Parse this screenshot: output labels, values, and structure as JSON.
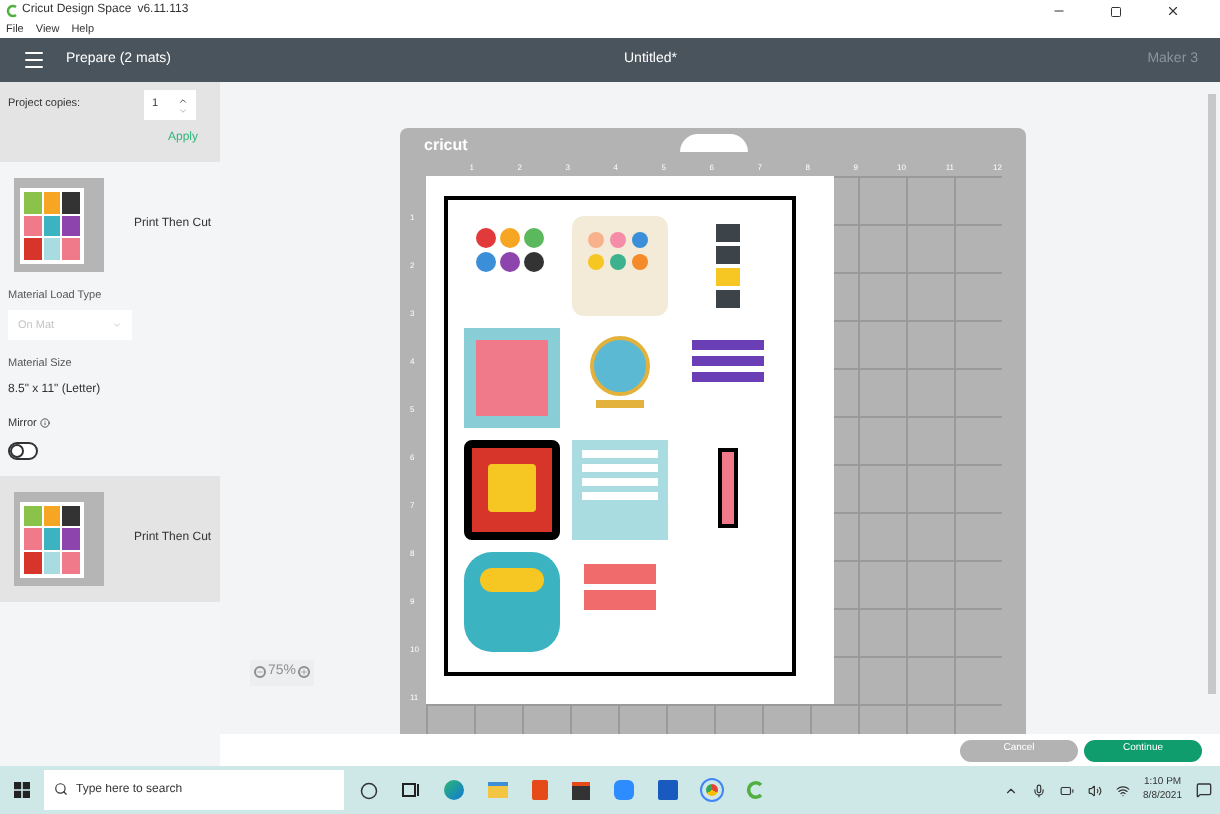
{
  "window": {
    "title": "Cricut Design Space",
    "version": "v6.11.113"
  },
  "menu": [
    "File",
    "View",
    "Help"
  ],
  "header": {
    "title": "Prepare (2 mats)",
    "document": "Untitled*",
    "machine": "Maker 3"
  },
  "copies": {
    "label": "Project copies:",
    "value": "1",
    "apply": "Apply"
  },
  "mats": [
    {
      "label": "Print Then Cut",
      "selected": true
    },
    {
      "label": "Print Then Cut",
      "selected": false
    }
  ],
  "options": {
    "load_label": "Material Load Type",
    "load_value": "On Mat",
    "load_disabled": true,
    "size_label": "Material Size",
    "size_value": "8.5\" x 11\" (Letter)",
    "mirror_label": "Mirror",
    "mirror_on": false
  },
  "canvas": {
    "brand": "cricut",
    "top_ruler": [
      "1",
      "2",
      "3",
      "4",
      "5",
      "6",
      "7",
      "8",
      "9",
      "10",
      "11",
      "12"
    ],
    "left_ruler": [
      "1",
      "2",
      "3",
      "4",
      "5",
      "6",
      "7",
      "8",
      "9",
      "10",
      "11"
    ],
    "zoom": "75%"
  },
  "buttons": [
    {
      "label": "Cancel",
      "disabled": true
    },
    {
      "label": "Continue",
      "disabled": false
    }
  ],
  "taskbar": {
    "search_placeholder": "Type here to search",
    "time": "1:10 PM",
    "date": "8/8/2021"
  }
}
